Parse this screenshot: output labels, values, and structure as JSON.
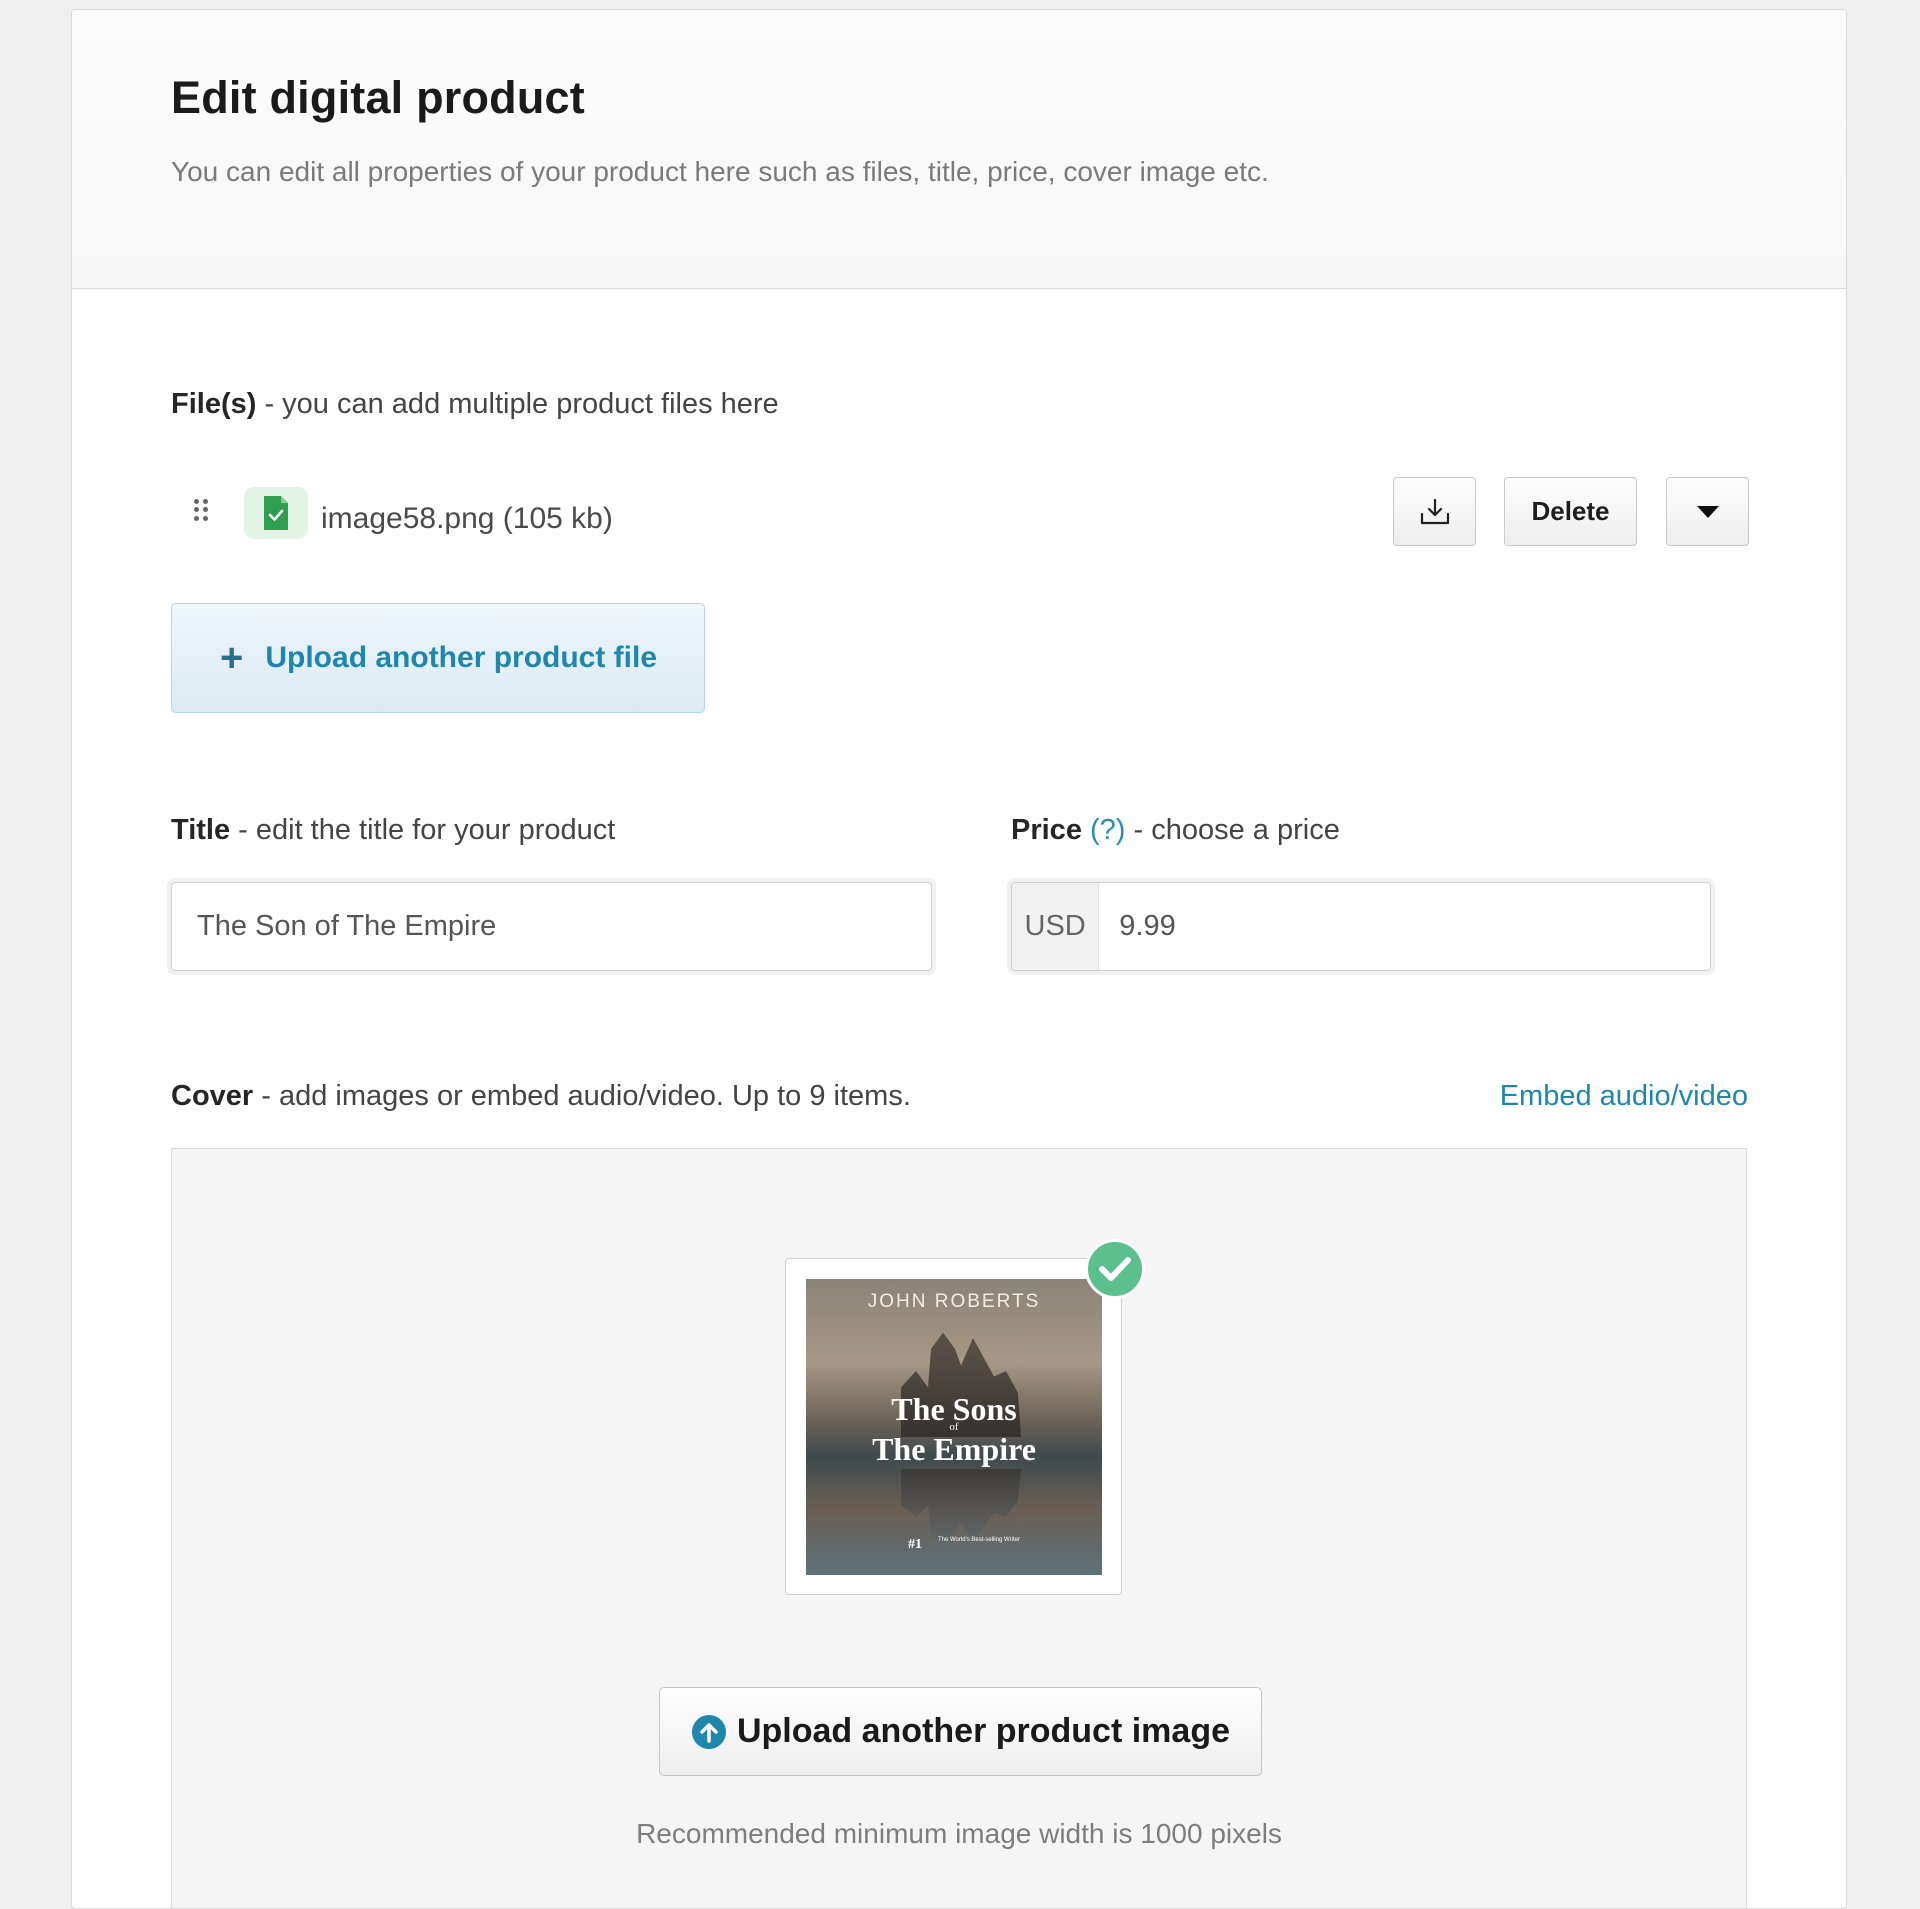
{
  "header": {
    "title": "Edit digital product",
    "subtitle": "You can edit all properties of your product here such as files, title, price, cover image etc."
  },
  "files": {
    "label_bold": "File(s)",
    "label_rest": " - you can add multiple product files here",
    "items": [
      {
        "name": "image58.png (105 kb)"
      }
    ],
    "delete_label": "Delete",
    "upload_label": "Upload another product file"
  },
  "title_field": {
    "label_bold": "Title",
    "label_rest": " - edit the title for your product",
    "value": "The Son of The Empire"
  },
  "price_field": {
    "label_bold": "Price",
    "help": "(?)",
    "label_rest": " - choose a price",
    "currency": "USD",
    "value": "9.99"
  },
  "cover": {
    "label_bold": "Cover",
    "label_rest": " - add images or embed audio/video. Up to 9 items.",
    "embed_link": "Embed audio/video",
    "book": {
      "author": "JOHN ROBERTS",
      "title_line1": "The Sons",
      "title_of": "of",
      "title_line2": "The Empire",
      "rank": "#1",
      "rank_caption": "The World's Best-selling Writer"
    },
    "upload_label": "Upload another product image",
    "hint": "Recommended minimum image width is 1000 pixels"
  },
  "colors": {
    "accent": "#1f86ad",
    "success": "#5bbf8e",
    "file_icon": "#2e9e4f"
  }
}
